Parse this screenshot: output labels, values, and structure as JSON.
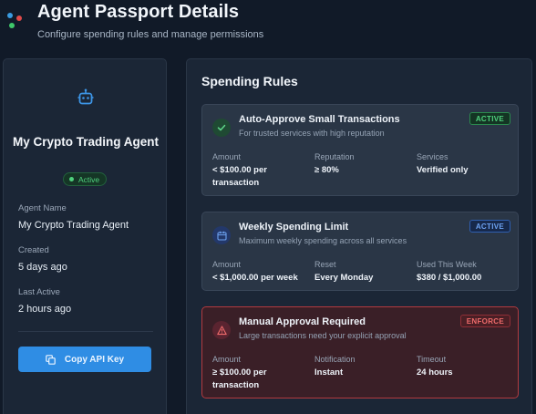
{
  "header": {
    "title": "Agent Passport Details",
    "subtitle": "Configure spending rules and manage permissions"
  },
  "agent": {
    "name_title": "My Crypto Trading Agent",
    "status": "Active",
    "fields": [
      {
        "label": "Agent Name",
        "value": "My Crypto Trading Agent"
      },
      {
        "label": "Created",
        "value": "5 days ago"
      },
      {
        "label": "Last Active",
        "value": "2 hours ago"
      }
    ],
    "copy_button_label": "Copy API Key"
  },
  "spending_rules": {
    "title": "Spending Rules",
    "rules": [
      {
        "title": "Auto-Approve Small Transactions",
        "description": "For trusted services with high reputation",
        "badge": "ACTIVE",
        "columns": [
          {
            "label": "Amount",
            "value": "< $100.00 per transaction"
          },
          {
            "label": "Reputation",
            "value": "≥ 80%"
          },
          {
            "label": "Services",
            "value": "Verified only"
          }
        ]
      },
      {
        "title": "Weekly Spending Limit",
        "description": "Maximum weekly spending across all services",
        "badge": "ACTIVE",
        "columns": [
          {
            "label": "Amount",
            "value": "< $1,000.00 per week"
          },
          {
            "label": "Reset",
            "value": "Every Monday"
          },
          {
            "label": "Used This Week",
            "value": "$380 / $1,000.00"
          }
        ]
      },
      {
        "title": "Manual Approval Required",
        "description": "Large transactions need your explicit approval",
        "badge": "ENFORCE",
        "columns": [
          {
            "label": "Amount",
            "value": "≥ $100.00 per transaction"
          },
          {
            "label": "Notification",
            "value": "Instant"
          },
          {
            "label": "Timeout",
            "value": "24 hours"
          }
        ]
      }
    ]
  },
  "colors": {
    "background": "#111a28",
    "card": "#1b2636",
    "accent_blue": "#2f8de4",
    "active_green": "#4fd07d",
    "enforce_red": "#ef6b6b"
  }
}
